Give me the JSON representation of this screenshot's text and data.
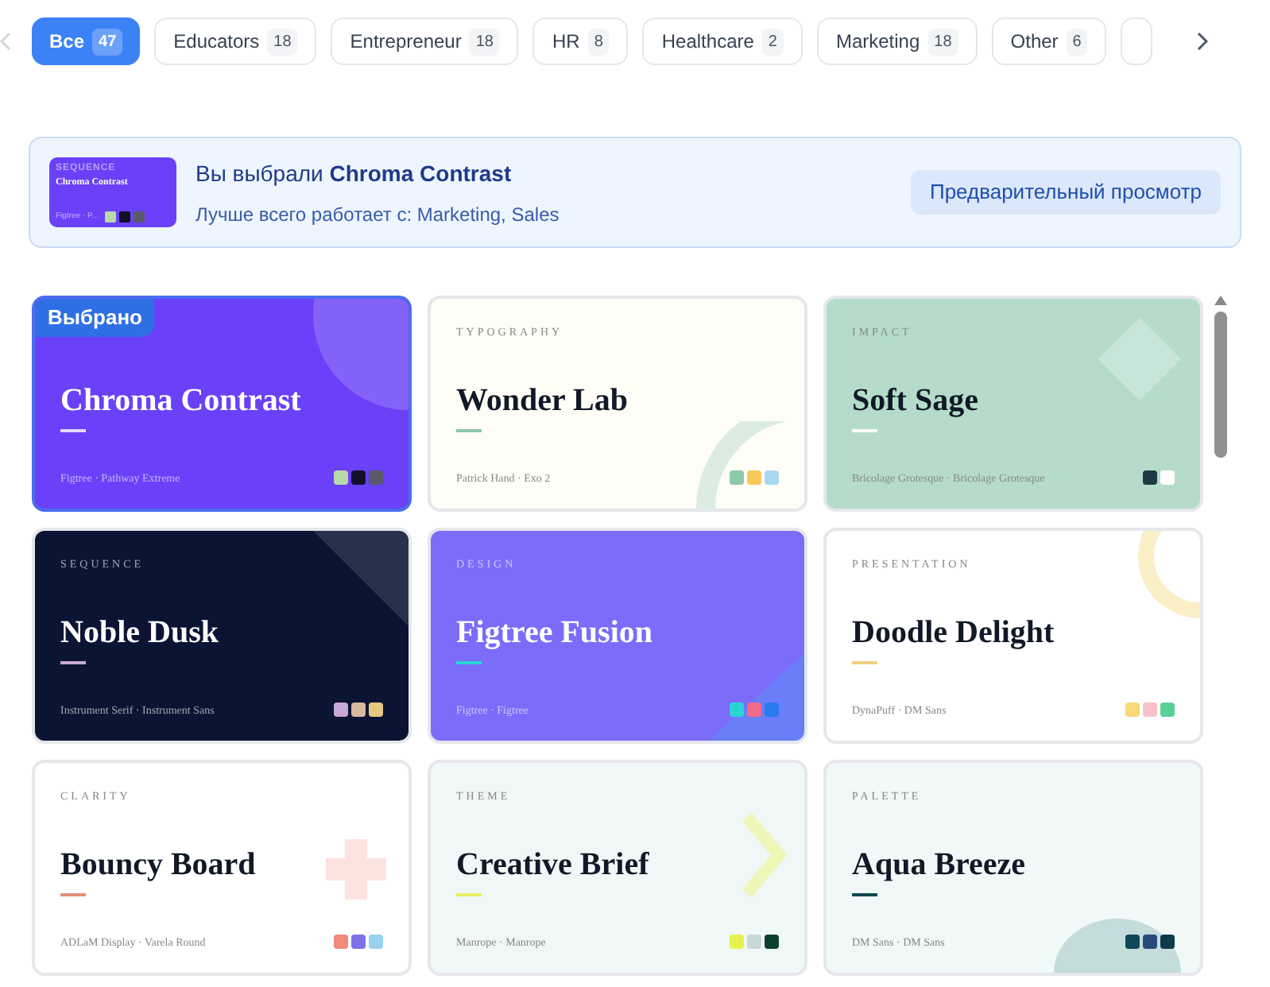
{
  "tabs": [
    {
      "label": "Все",
      "count": "47",
      "selected": true
    },
    {
      "label": "Educators",
      "count": "18",
      "selected": false
    },
    {
      "label": "Entrepreneur",
      "count": "18",
      "selected": false
    },
    {
      "label": "HR",
      "count": "8",
      "selected": false
    },
    {
      "label": "Healthcare",
      "count": "2",
      "selected": false
    },
    {
      "label": "Marketing",
      "count": "18",
      "selected": false
    },
    {
      "label": "Other",
      "count": "6",
      "selected": false
    }
  ],
  "banner": {
    "thumbnail": {
      "category": "SEQUENCE",
      "title": "Chroma Contrast",
      "fonts": "Figtree · P...",
      "swatches": [
        {
          "color": "#b8d8a8"
        },
        {
          "color": "#14102a"
        },
        {
          "color": "#5a5a6a"
        }
      ]
    },
    "title": "Вы выбрали **Chroma Contrast**",
    "subtitle": "Лучше всего работает с: Marketing, Sales",
    "button": "Предварительный просмотр"
  },
  "cards": [
    {
      "kind": "circle",
      "badge": "Выбрано",
      "title": "Chroma Contrast",
      "fonts": "Figtree · Pathway Extreme",
      "selected": true,
      "dark": true,
      "color": "#6a40f8",
      "accent": {
        "color": "#e0d8ff"
      },
      "swatches": [
        {
          "color": "#b8d8a8"
        },
        {
          "color": "#14102a"
        },
        {
          "color": "#5a5a6a"
        }
      ]
    },
    {
      "kind": "arc",
      "category": "TYPOGRAPHY",
      "title": "Wonder Lab",
      "fonts": "Patrick Hand · Exo 2",
      "selected": false,
      "dark": false,
      "color": "#fffef6",
      "accent": {
        "color": "#8cc9a8"
      },
      "swatches": [
        {
          "color": "#8cc9a8"
        },
        {
          "color": "#f8c95a"
        },
        {
          "color": "#a8d8f0"
        }
      ]
    },
    {
      "kind": "diamond",
      "category": "IMPACT",
      "title": "Soft Sage",
      "fonts": "Bricolage Grotesque · Bricolage Grotesque",
      "selected": false,
      "dark": false,
      "color": "#b5dccb",
      "accent": {
        "color": "#ffffff"
      },
      "swatches": [
        {
          "color": "#1f3a44"
        },
        {
          "color": "#ffffff"
        }
      ]
    },
    {
      "kind": "corner",
      "category": "SEQUENCE",
      "title": "Noble Dusk",
      "fonts": "Instrument Serif · Instrument Sans",
      "selected": false,
      "dark": true,
      "color": "#0b1433",
      "accent": {
        "color": "#c8a8d8"
      },
      "swatches": [
        {
          "color": "#c8a8d8"
        },
        {
          "color": "#d8b8a0"
        },
        {
          "color": "#e8c880"
        }
      ]
    },
    {
      "kind": "triangle",
      "category": "DESIGN",
      "title": "Figtree Fusion",
      "fonts": "Figtree · Figtree",
      "selected": false,
      "dark": true,
      "color": "#7c6cfa",
      "accent": {
        "color": "#2ad4d4"
      },
      "swatches": [
        {
          "color": "#2ad4d4"
        },
        {
          "color": "#f06a8a"
        },
        {
          "color": "#2a7af0"
        }
      ]
    },
    {
      "kind": "ring",
      "category": "PRESENTATION",
      "title": "Doodle Delight",
      "fonts": "DynaPuff · DM Sans",
      "selected": false,
      "dark": false,
      "color": "#ffffff",
      "accent": {
        "color": "#f0d080"
      },
      "swatches": [
        {
          "color": "#f8d878"
        },
        {
          "color": "#f8c0c8"
        },
        {
          "color": "#5ad098"
        }
      ]
    },
    {
      "kind": "plus",
      "category": "CLARITY",
      "title": "Bouncy Board",
      "fonts": "ADLaM Display · Varela Round",
      "selected": false,
      "dark": false,
      "color": "#ffffff",
      "accent": {
        "color": "#e0907a"
      },
      "swatches": [
        {
          "color": "#f08a7a"
        },
        {
          "color": "#7a72e8"
        },
        {
          "color": "#9ad0f0"
        }
      ]
    },
    {
      "kind": "chevron",
      "category": "THEME",
      "title": "Creative Brief",
      "fonts": "Manrope · Manrope",
      "selected": false,
      "dark": false,
      "color": "#f0f7f7",
      "accent": {
        "color": "#e8f060"
      },
      "swatches": [
        {
          "color": "#e8f050"
        },
        {
          "color": "#c8d8d8"
        },
        {
          "color": "#0e4030"
        }
      ]
    },
    {
      "kind": "halfcircle",
      "category": "PALETTE",
      "title": "Aqua Breeze",
      "fonts": "DM Sans · DM Sans",
      "selected": false,
      "dark": false,
      "color": "#f0f8f8",
      "accent": {
        "color": "#0e4a50"
      },
      "swatches": [
        {
          "color": "#104858"
        },
        {
          "color": "#2a4a7a"
        },
        {
          "color": "#0e3a4a"
        }
      ]
    }
  ]
}
